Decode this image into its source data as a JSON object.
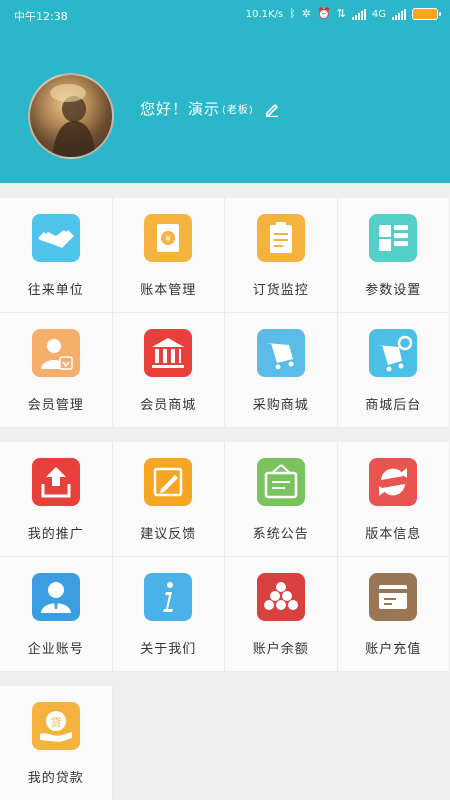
{
  "status_bar": {
    "time": "中午12:38",
    "speed": "10.1K/s",
    "network": "4G"
  },
  "profile": {
    "greeting": "您好！演示",
    "role": "(老板)"
  },
  "section1": [
    {
      "label": "往来单位",
      "icon": "handshake-icon",
      "color": "#4fc3ec"
    },
    {
      "label": "账本管理",
      "icon": "ledger-icon",
      "color": "#f5b23e"
    },
    {
      "label": "订货监控",
      "icon": "clipboard-icon",
      "color": "#f5b23e"
    },
    {
      "label": "参数设置",
      "icon": "grid-settings-icon",
      "color": "#54d0c9"
    },
    {
      "label": "会员管理",
      "icon": "member-icon",
      "color": "#f6ae6b"
    },
    {
      "label": "会员商城",
      "icon": "bank-icon",
      "color": "#e8413b"
    },
    {
      "label": "采购商城",
      "icon": "cart-icon",
      "color": "#5bbde7"
    },
    {
      "label": "商城后台",
      "icon": "cart-settings-icon",
      "color": "#4cbfe6"
    }
  ],
  "section2": [
    {
      "label": "我的推广",
      "icon": "share-upload-icon",
      "color": "#e8413b"
    },
    {
      "label": "建议反馈",
      "icon": "feedback-pencil-icon",
      "color": "#f5a623"
    },
    {
      "label": "系统公告",
      "icon": "notice-board-icon",
      "color": "#7ac35e"
    },
    {
      "label": "版本信息",
      "icon": "refresh-icon",
      "color": "#e85450"
    },
    {
      "label": "企业账号",
      "icon": "enterprise-user-icon",
      "color": "#3a9ee0"
    },
    {
      "label": "关于我们",
      "icon": "info-icon",
      "color": "#4ab1e9"
    },
    {
      "label": "账户余额",
      "icon": "balance-icon",
      "color": "#d9413f"
    },
    {
      "label": "账户充值",
      "icon": "recharge-card-icon",
      "color": "#9b7654"
    }
  ],
  "section3": [
    {
      "label": "我的贷款",
      "icon": "loan-icon",
      "color": "#f5b23e"
    }
  ]
}
